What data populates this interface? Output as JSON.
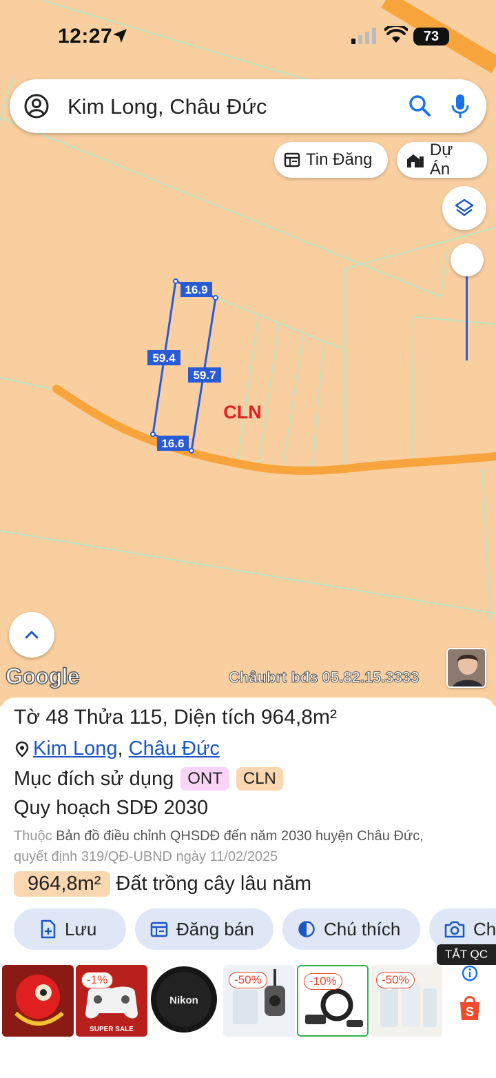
{
  "status_bar": {
    "time": "12:27",
    "battery": "73"
  },
  "search": {
    "value": "Kim Long, Châu Đức"
  },
  "chips": {
    "tin_dang": "Tin Đăng",
    "du_an": "Dự Án"
  },
  "map": {
    "land_label": "CLN",
    "edges": {
      "top": "16.9",
      "left": "59.4",
      "right": "59.7",
      "bottom": "16.6"
    },
    "watermark": "Châubrt bđs 05.82.15.3333",
    "google": "Google"
  },
  "parcel": {
    "to_label": "Tờ",
    "to": "48",
    "thua_label": "Thửa",
    "thua": "115",
    "dien_tich_label": ", Diện tích",
    "dien_tich": "964,8m²",
    "commune": "Kim Long",
    "district": "Châu Đức",
    "purpose_label": "Mục đích sử dụng",
    "purposes": [
      "ONT",
      "CLN"
    ],
    "plan_title": "Quy hoạch SDĐ 2030",
    "plan_prefix": "Thuộc",
    "plan_name": "Bản đồ điều chỉnh QHSDĐ đến năm 2030 huyện Châu Đức,",
    "plan_decision": "quyết định 319/QĐ-UBND ngày 11/02/2025",
    "area_value": "964,8m²",
    "area_type": "Đất trồng cây lâu năm"
  },
  "actions": {
    "luu": "Lưu",
    "dang_ban": "Đăng bán",
    "chu_thich": "Chú thích",
    "ch": "Ch"
  },
  "ads": {
    "label": "TẮT QC",
    "items": [
      {
        "discount": ""
      },
      {
        "discount": "-1%",
        "text": "SUPER SALE"
      },
      {
        "discount": "",
        "text": "Nikon"
      },
      {
        "discount": "-50%"
      },
      {
        "discount": "-10%"
      },
      {
        "discount": "-50%"
      }
    ]
  },
  "colors": {
    "map_bg": "#f9cfa0",
    "road": "#f7a43c",
    "parcel_line": "#2a5bd7",
    "accent": "#1a56c4",
    "cln_red": "#e02020"
  }
}
